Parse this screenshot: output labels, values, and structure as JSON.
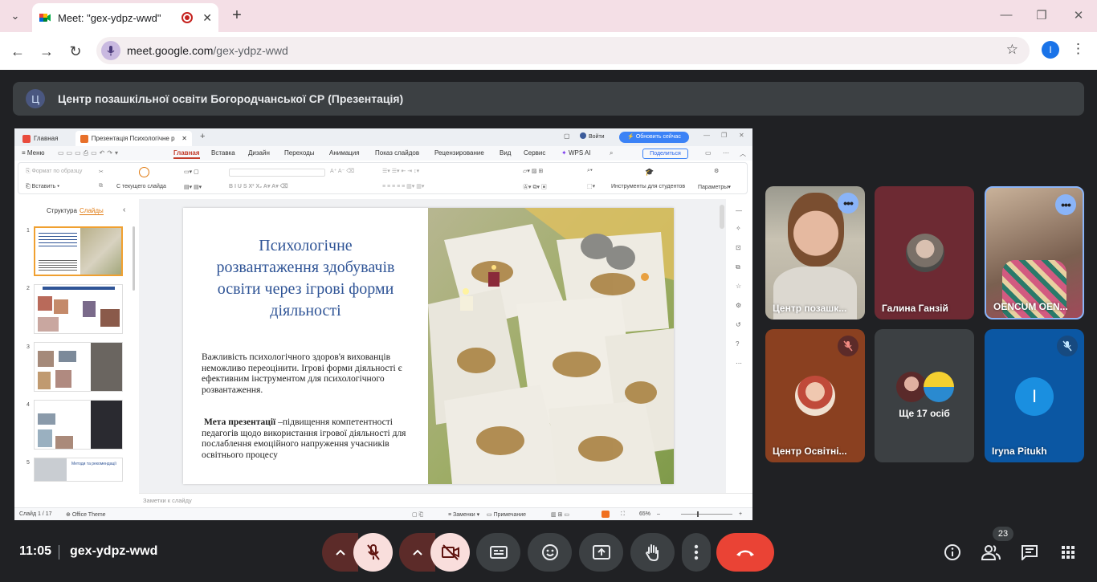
{
  "browser": {
    "tab_title": "Meet: \"gex-ydpz-wwd\"",
    "tab_close": "✕",
    "new_tab": "+",
    "url_host": "meet.google.com",
    "url_path": "/gex-ydpz-wwd",
    "profile_initial": "I"
  },
  "meet": {
    "presenter_avatar": "Ц",
    "presentation_title": "Центр позашкільної освіти Богородчанської СР (Презентація)",
    "time": "11:05",
    "meeting_code": "gex-ydpz-wwd",
    "participant_count": "23",
    "tiles": [
      {
        "name": "Центр позашк..."
      },
      {
        "name": "Галина Ганзій"
      },
      {
        "name": "OENCUM OEN..."
      },
      {
        "name": "Центр Освітні..."
      },
      {
        "name": "Ще 17 осіб"
      },
      {
        "name": "Iryna Pitukh",
        "initial": "I"
      }
    ]
  },
  "wps": {
    "tab_home": "Главная",
    "tab_doc": "Презентація Психологічне р",
    "login": "Войти",
    "update": "Обновить сейчас",
    "menu": [
      "Меню",
      "Главная",
      "Вставка",
      "Дизайн",
      "Переходы",
      "Анимация",
      "Показ слайдов",
      "Рецензирование",
      "Вид",
      "Сервис",
      "WPS AI"
    ],
    "share": "Поделиться",
    "ribbon": {
      "format_painter": "Формат по образцу",
      "paste": "Вставить",
      "from_current": "С текущего слайда",
      "student_tools": "Инструменты для студентов",
      "params": "Параметры"
    },
    "panel_tabs": [
      "Структура",
      "Слайды"
    ],
    "notes_placeholder": "Заметки к слайду",
    "status": {
      "slide": "Слайд 1 / 17",
      "theme": "Office Theme",
      "notes": "Заменки",
      "comment": "Примечание",
      "zoom": "65%"
    },
    "thumb_nums": [
      "1",
      "2",
      "3",
      "4",
      "5"
    ],
    "thumb5_title": "Методи та рекомендації"
  },
  "slide": {
    "title": "Психологічне розвантаження здобувачів освіти через ігрові форми діяльності",
    "paragraph": "Важливість психологічного здоров'я вихованців неможливо переоцінити. Ігрові форми діяльності є ефективним інструментом для психологічного розвантаження.",
    "goal_label": "Мета презентації",
    "goal_text": " –підвищення компетентності педагогів щодо використання ігрової діяльності для послаблення емоційного напруження учасників освітнього процесу"
  }
}
